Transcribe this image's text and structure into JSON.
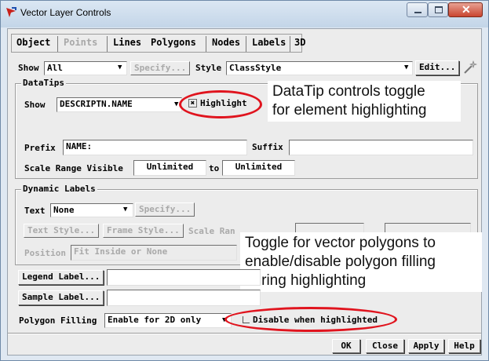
{
  "window": {
    "title": "Vector Layer Controls"
  },
  "tabs": [
    {
      "label": "Object",
      "disabled": false
    },
    {
      "label": "Points",
      "disabled": true
    },
    {
      "label": "Lines",
      "disabled": false
    },
    {
      "label": "Polygons",
      "disabled": false,
      "selected": true
    },
    {
      "label": "Nodes",
      "disabled": false
    },
    {
      "label": "Labels",
      "disabled": false
    },
    {
      "label": "3D",
      "disabled": false
    }
  ],
  "show_row": {
    "show_label": "Show",
    "show_value": "All",
    "specify_label": "Specify...",
    "style_label": "Style",
    "style_value": "ClassStyle",
    "edit_label": "Edit..."
  },
  "datatips": {
    "group_label": "DataTips",
    "show_label": "Show",
    "show_value": "DESCRIPTN.NAME",
    "highlight_label": "Highlight",
    "highlight_checked": true,
    "prefix_label": "Prefix",
    "prefix_value": "NAME:",
    "suffix_label": "Suffix",
    "suffix_value": "",
    "scale_label": "Scale Range Visible",
    "scale_from": "Unlimited",
    "scale_to_label": "to",
    "scale_to": "Unlimited"
  },
  "dynamic_labels": {
    "group_label": "Dynamic Labels",
    "text_label": "Text",
    "text_value": "None",
    "specify_label": "Specify...",
    "text_style_label": "Text Style...",
    "frame_style_label": "Frame Style...",
    "scale_range_label": "Scale Ran",
    "position_label": "Position",
    "position_value": "Fit Inside or None"
  },
  "legend_label_button": "Legend Label...",
  "sample_label_button": "Sample Label...",
  "polygon_filling": {
    "label": "Polygon Filling",
    "value": "Enable for 2D only",
    "disable_label": "Disable when highlighted",
    "disable_checked": false
  },
  "bottom_buttons": {
    "ok": "OK",
    "close": "Close",
    "apply": "Apply",
    "help": "Help"
  },
  "annotations": {
    "top_line1": "DataTip controls toggle",
    "top_line2": "for element highlighting",
    "bottom_line1": "Toggle for vector polygons to",
    "bottom_line2": "enable/disable polygon filling",
    "bottom_line3": "during highlighting"
  },
  "colors": {
    "annotation_ellipse": "#e0141e",
    "close_button": "#c94530"
  }
}
